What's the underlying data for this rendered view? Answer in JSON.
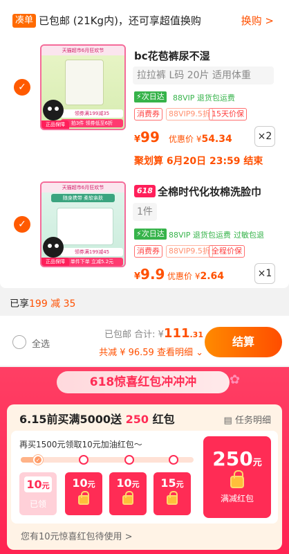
{
  "topbar": {
    "tag": "凑单",
    "text": "已包邮 (21Kg内)，还可享超值换购",
    "link": "换购 >"
  },
  "items": [
    {
      "thumb_band": "天猫超市6月狂欢节",
      "thumb_note1": "领券满199减35",
      "thumb_note2": "拍3件 领券低至6折",
      "thumb_cat": "正品保障",
      "title": "bc花苞裤尿不湿",
      "sku": "拉拉裤 L码 20片 适用体重",
      "badge": "⚡次日达",
      "badge_note": "88VIP 退货包运费",
      "tags": [
        "消费券",
        "88VIP9.5折",
        "15天价保"
      ],
      "price_symbol": "¥",
      "price": "99",
      "promo_label": "优惠价 ¥",
      "promo_price": "54.34",
      "qty": "×2",
      "deadline": "聚划算 6月20日 23:59 结束"
    },
    {
      "thumb_band": "天猫超市6月狂欢节",
      "thumb_band2": "随身携带 柔软亲肤",
      "thumb_note1": "领券满199减45",
      "thumb_note2": "单件下单 立减5.2元",
      "thumb_cat": "正品保障",
      "tag618": "618",
      "title": "全棉时代化妆棉洗脸巾",
      "sku": "1件",
      "badge": "⚡次日达",
      "badge_note": "88VIP 退货包运费",
      "badge_note2": "过敏包退",
      "tags": [
        "消费券",
        "88VIP9.5折",
        "全程价保"
      ],
      "price_symbol": "¥",
      "price": "9.9",
      "promo_label": "优惠价 ¥",
      "promo_price": "2.64",
      "qty": "×1"
    }
  ],
  "summary": {
    "enjoyed_prefix": "已享",
    "enjoyed_value": "199 减 35",
    "select_all": "全选",
    "total_label": "已包邮 合计: ¥",
    "total_main": "111",
    "total_cents": ".31",
    "saved": "共减 ¥ 96.59 查看明细 ⌄",
    "checkout": "结算"
  },
  "promo": {
    "banner": "618惊喜红包冲冲冲",
    "head_main": "6.15前买满5000送",
    "head_amount": "250",
    "head_suffix": "红包",
    "task_link": "任务明细",
    "hint": "再买1500元领取10元加油红包～",
    "coupons": [
      {
        "amount": "10",
        "unit": "元",
        "label": "已领"
      },
      {
        "amount": "10",
        "unit": "元"
      },
      {
        "amount": "10",
        "unit": "元"
      },
      {
        "amount": "15",
        "unit": "元"
      }
    ],
    "big_coupon": {
      "amount": "250",
      "unit": "元",
      "label": "满减红包"
    },
    "bottom_note": "您有10元惊喜红包待使用 >"
  },
  "colors": {
    "accent": "#ff5000",
    "promo_red": "#ff2c55",
    "checkout_gradient": [
      "#ff8a00",
      "#ff4d00"
    ]
  }
}
